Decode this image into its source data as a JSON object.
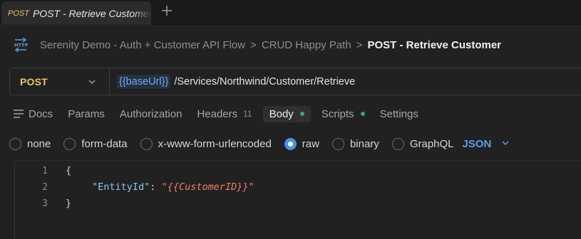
{
  "tab": {
    "method": "POST",
    "title": "POST - Retrieve Customer"
  },
  "breadcrumb": {
    "collection": "Serenity Demo - Auth + Customer API Flow",
    "folder": "CRUD Happy Path",
    "request": "POST - Retrieve Customer",
    "separator": ">"
  },
  "request": {
    "method": "POST",
    "url_variable": "{{baseUrl}}",
    "url_path": "/Services/Northwind/Customer/Retrieve"
  },
  "request_tabs": [
    {
      "label": "Docs"
    },
    {
      "label": "Params"
    },
    {
      "label": "Authorization"
    },
    {
      "label": "Headers",
      "count": "11"
    },
    {
      "label": "Body",
      "active": true,
      "indicator": true
    },
    {
      "label": "Scripts",
      "indicator": true
    },
    {
      "label": "Settings"
    }
  ],
  "body_types": [
    {
      "label": "none",
      "selected": false
    },
    {
      "label": "form-data",
      "selected": false
    },
    {
      "label": "x-www-form-urlencoded",
      "selected": false
    },
    {
      "label": "raw",
      "selected": true
    },
    {
      "label": "binary",
      "selected": false
    },
    {
      "label": "GraphQL",
      "selected": false
    }
  ],
  "raw_language": "JSON",
  "editor": {
    "line_numbers": [
      "1",
      "2",
      "3"
    ],
    "open_brace": "{",
    "key": "\"EntityId\"",
    "colon": ": ",
    "value": "{{CustomerID}}",
    "close_brace": "}"
  },
  "colors": {
    "method": "#e9c46a",
    "variable": "#74aaf5",
    "accent": "#4a8fe6",
    "indicator": "#3aa86b",
    "json_key": "#8fc4ee",
    "json_string": "#f07e62"
  },
  "icons": [
    "http-icon",
    "plus-icon",
    "chevron-down-icon",
    "docs-icon",
    "radio-button"
  ]
}
